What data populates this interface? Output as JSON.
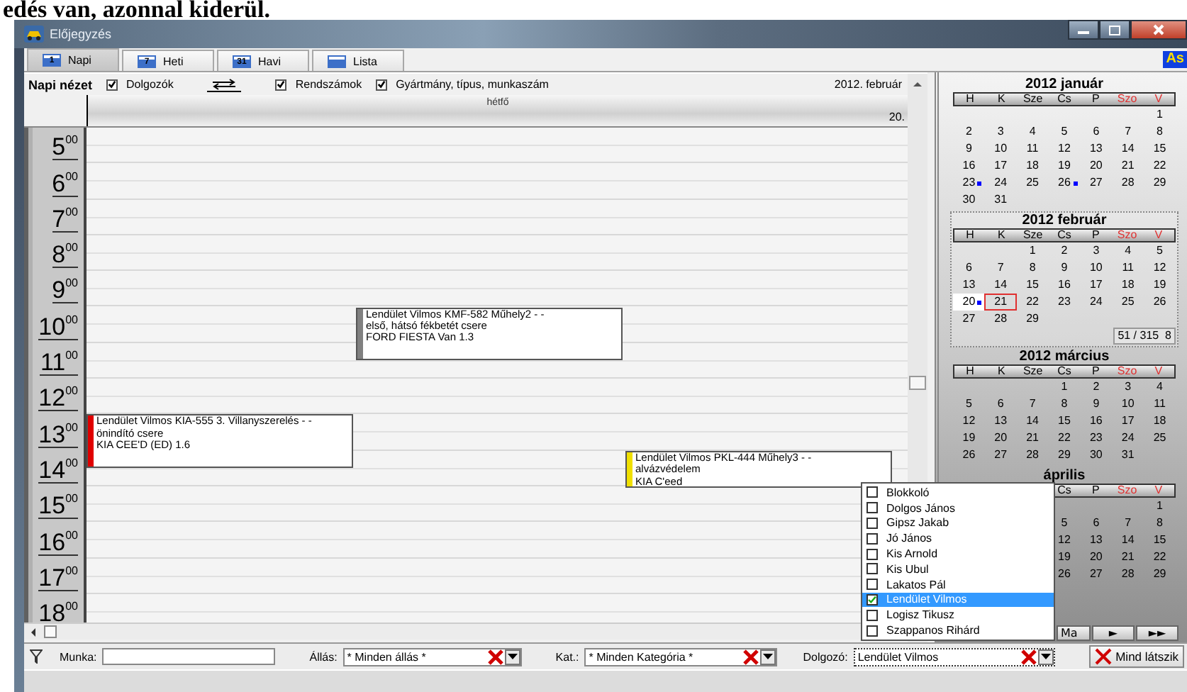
{
  "document_text": "edés van, azonnal kiderül.",
  "window": {
    "title": "Előjegyzés"
  },
  "tabs": [
    {
      "label": "Napi",
      "icon_text": "1",
      "selected": true
    },
    {
      "label": "Heti",
      "icon_text": "7",
      "selected": false
    },
    {
      "label": "Havi",
      "icon_text": "31",
      "selected": false
    },
    {
      "label": "Lista",
      "selected": false
    }
  ],
  "badge": "As",
  "toolbar": {
    "title": "Napi nézet",
    "options": [
      {
        "label": "Dolgozók",
        "checked": true
      },
      {
        "label": "Rendszámok",
        "checked": true
      },
      {
        "label": "Gyártmány, típus, munkaszám",
        "checked": true
      }
    ],
    "month": "2012. február"
  },
  "day_header": {
    "weekday": "hétfő",
    "date": "20."
  },
  "hours": [
    "5$^{00}$",
    "6$^{00}$",
    "7$^{00}$",
    "8$^{00}$",
    "9$^{00}$",
    "10$^{00}$",
    "11$^{00}$",
    "12$^{00}$",
    "13$^{00}$",
    "14$^{00}$",
    "15$^{00}$",
    "16$^{00}$",
    "17$^{00}$",
    "18$^{00}$"
  ],
  "events": [
    {
      "color": "#808080",
      "lines": [
        "Lendület Vilmos KMF-582 Műhely2 -  -",
        "első, hátsó fékbetét csere",
        "FORD FIESTA Van 1.3"
      ]
    },
    {
      "color": "#e00000",
      "lines": [
        "Lendület Vilmos KIA-555 3. Villanyszerelés -  -",
        "önindító csere",
        "KIA CEE'D (ED) 1.6"
      ]
    },
    {
      "color": "#f0e000",
      "lines": [
        "Lendület Vilmos PKL-444 Műhely3 -  -",
        "alvázvédelem",
        "KIA C'eed"
      ]
    }
  ],
  "calendar": {
    "months": [
      {
        "title": "2012 január",
        "boxed": false,
        "weekdays": [
          {
            "label": "H",
            "weekend": false
          },
          {
            "label": "K",
            "weekend": false
          },
          {
            "label": "Sze",
            "weekend": false
          },
          {
            "label": "Cs",
            "weekend": false
          },
          {
            "label": "P",
            "weekend": false
          },
          {
            "label": "Szo",
            "weekend": true
          },
          {
            "label": "V",
            "weekend": true
          }
        ],
        "weeks": [
          [
            {
              "d": "1",
              "selected": false
            }
          ],
          [
            {
              "d": "2",
              "selected": false
            },
            {
              "d": "3",
              "selected": false
            },
            {
              "d": "4",
              "selected": false
            },
            {
              "d": "5",
              "selected": false
            },
            {
              "d": "6",
              "selected": false
            },
            {
              "d": "7",
              "selected": false
            },
            {
              "d": "8",
              "selected": false
            }
          ],
          [
            {
              "d": "9",
              "selected": false
            },
            {
              "d": "10",
              "selected": false
            },
            {
              "d": "11",
              "selected": false
            },
            {
              "d": "12",
              "selected": false
            },
            {
              "d": "13",
              "selected": false
            },
            {
              "d": "14",
              "selected": false
            },
            {
              "d": "15",
              "selected": false
            }
          ],
          [
            {
              "d": "16",
              "selected": false
            },
            {
              "d": "17",
              "selected": false
            },
            {
              "d": "18",
              "selected": false
            },
            {
              "d": "19",
              "selected": false
            },
            {
              "d": "20",
              "selected": false
            },
            {
              "d": "21",
              "selected": false
            },
            {
              "d": "22",
              "selected": false
            }
          ],
          [
            {
              "d": "23",
              "selected": false,
              "dot": true
            },
            {
              "d": "24",
              "selected": false
            },
            {
              "d": "25",
              "selected": false
            },
            {
              "d": "26",
              "selected": false,
              "dot": true
            },
            {
              "d": "27",
              "selected": false
            },
            {
              "d": "28",
              "selected": false
            },
            {
              "d": "29",
              "selected": false
            }
          ],
          [
            {
              "d": "30",
              "selected": false
            },
            {
              "d": "31",
              "selected": false
            }
          ]
        ]
      },
      {
        "title": "2012 február",
        "boxed": true,
        "counter": "51 / 315  8",
        "weekdays": [
          {
            "label": "H",
            "weekend": false
          },
          {
            "label": "K",
            "weekend": false
          },
          {
            "label": "Sze",
            "weekend": false
          },
          {
            "label": "Cs",
            "weekend": false
          },
          {
            "label": "P",
            "weekend": false
          },
          {
            "label": "Szo",
            "weekend": true
          },
          {
            "label": "V",
            "weekend": true
          }
        ],
        "weeks": [
          [
            {
              "d": "1",
              "selected": false
            },
            {
              "d": "2",
              "selected": false
            },
            {
              "d": "3",
              "selected": false
            },
            {
              "d": "4",
              "selected": false
            },
            {
              "d": "5",
              "selected": false
            }
          ],
          [
            {
              "d": "6",
              "selected": false
            },
            {
              "d": "7",
              "selected": false
            },
            {
              "d": "8",
              "selected": false
            },
            {
              "d": "9",
              "selected": false
            },
            {
              "d": "10",
              "selected": false
            },
            {
              "d": "11",
              "selected": false
            },
            {
              "d": "12",
              "selected": false
            }
          ],
          [
            {
              "d": "13",
              "selected": false
            },
            {
              "d": "14",
              "selected": false
            },
            {
              "d": "15",
              "selected": false
            },
            {
              "d": "16",
              "selected": false
            },
            {
              "d": "17",
              "selected": false
            },
            {
              "d": "18",
              "selected": false
            },
            {
              "d": "19",
              "selected": false
            }
          ],
          [
            {
              "d": "20",
              "selected": true,
              "dot": true
            },
            {
              "d": "21",
              "selected": false,
              "today": true
            },
            {
              "d": "22",
              "selected": false
            },
            {
              "d": "23",
              "selected": false
            },
            {
              "d": "24",
              "selected": false
            },
            {
              "d": "25",
              "selected": false
            },
            {
              "d": "26",
              "selected": false
            }
          ],
          [
            {
              "d": "27",
              "selected": false
            },
            {
              "d": "28",
              "selected": false
            },
            {
              "d": "29",
              "selected": false
            }
          ]
        ]
      },
      {
        "title": "2012 március",
        "boxed": false,
        "weekdays": [
          {
            "label": "H",
            "weekend": false
          },
          {
            "label": "K",
            "weekend": false
          },
          {
            "label": "Sze",
            "weekend": false
          },
          {
            "label": "Cs",
            "weekend": false
          },
          {
            "label": "P",
            "weekend": false
          },
          {
            "label": "Szo",
            "weekend": true
          },
          {
            "label": "V",
            "weekend": true
          }
        ],
        "weeks": [
          [
            {
              "d": "1",
              "selected": false
            },
            {
              "d": "2",
              "selected": false
            },
            {
              "d": "3",
              "selected": false
            },
            {
              "d": "4",
              "selected": false
            }
          ],
          [
            {
              "d": "5",
              "selected": false
            },
            {
              "d": "6",
              "selected": false
            },
            {
              "d": "7",
              "selected": false
            },
            {
              "d": "8",
              "selected": false
            },
            {
              "d": "9",
              "selected": false
            },
            {
              "d": "10",
              "selected": false
            },
            {
              "d": "11",
              "selected": false
            }
          ],
          [
            {
              "d": "12",
              "selected": false
            },
            {
              "d": "13",
              "selected": false
            },
            {
              "d": "14",
              "selected": false
            },
            {
              "d": "15",
              "selected": false
            },
            {
              "d": "16",
              "selected": false
            },
            {
              "d": "17",
              "selected": false
            },
            {
              "d": "18",
              "selected": false
            }
          ],
          [
            {
              "d": "19",
              "selected": false
            },
            {
              "d": "20",
              "selected": false
            },
            {
              "d": "21",
              "selected": false
            },
            {
              "d": "22",
              "selected": false
            },
            {
              "d": "23",
              "selected": false
            },
            {
              "d": "24",
              "selected": false
            },
            {
              "d": "25",
              "selected": false
            }
          ],
          [
            {
              "d": "26",
              "selected": false
            },
            {
              "d": "27",
              "selected": false
            },
            {
              "d": "28",
              "selected": false
            },
            {
              "d": "29",
              "selected": false
            },
            {
              "d": "30",
              "selected": false
            },
            {
              "d": "31",
              "selected": false
            }
          ]
        ]
      },
      {
        "title": "április",
        "boxed": false,
        "weekdays": [
          {
            "label": "Cs",
            "weekend": false
          },
          {
            "label": "P",
            "weekend": false
          },
          {
            "label": "Szo",
            "weekend": true
          },
          {
            "label": "V",
            "weekend": true
          }
        ],
        "weeks": [
          [
            {
              "d": "1",
              "selected": false
            }
          ],
          [
            {
              "d": "5",
              "selected": false
            },
            {
              "d": "6",
              "selected": false
            },
            {
              "d": "7",
              "selected": false
            },
            {
              "d": "8",
              "selected": false
            }
          ],
          [
            {
              "d": "12",
              "selected": false
            },
            {
              "d": "13",
              "selected": false
            },
            {
              "d": "14",
              "selected": false
            },
            {
              "d": "15",
              "selected": false
            }
          ],
          [
            {
              "d": "19",
              "selected": false
            },
            {
              "d": "20",
              "selected": false
            },
            {
              "d": "21",
              "selected": false
            },
            {
              "d": "22",
              "selected": false
            }
          ],
          [
            {
              "d": "26",
              "selected": false
            },
            {
              "d": "27",
              "selected": false
            },
            {
              "d": "28",
              "selected": false
            },
            {
              "d": "29",
              "selected": false
            }
          ]
        ]
      }
    ],
    "nav": [
      "Ma",
      "►",
      "►►"
    ]
  },
  "filters": {
    "work_label": "Munka:",
    "combos": [
      {
        "label": "Állás:",
        "value": "* Minden állás *"
      },
      {
        "label": "Kat.:",
        "value": "* Minden Kategória *"
      },
      {
        "label": "Dolgozó:",
        "value": "Lendület Vilmos"
      }
    ],
    "button": "Mind látszik"
  },
  "worker_list": [
    {
      "label": "Blokkoló",
      "checked": false,
      "selected": false
    },
    {
      "label": "Dolgos János",
      "checked": false,
      "selected": false
    },
    {
      "label": "Gipsz Jakab",
      "checked": false,
      "selected": false
    },
    {
      "label": "Jó János",
      "checked": false,
      "selected": false
    },
    {
      "label": "Kis Arnold",
      "checked": false,
      "selected": false
    },
    {
      "label": "Kis Ubul",
      "checked": false,
      "selected": false
    },
    {
      "label": "Lakatos Pál",
      "checked": false,
      "selected": false
    },
    {
      "label": "Lendület Vilmos",
      "checked": true,
      "selected": true
    },
    {
      "label": "Logisz Tikusz",
      "checked": false,
      "selected": false
    },
    {
      "label": "Szappanos Rihárd",
      "checked": false,
      "selected": false
    }
  ]
}
